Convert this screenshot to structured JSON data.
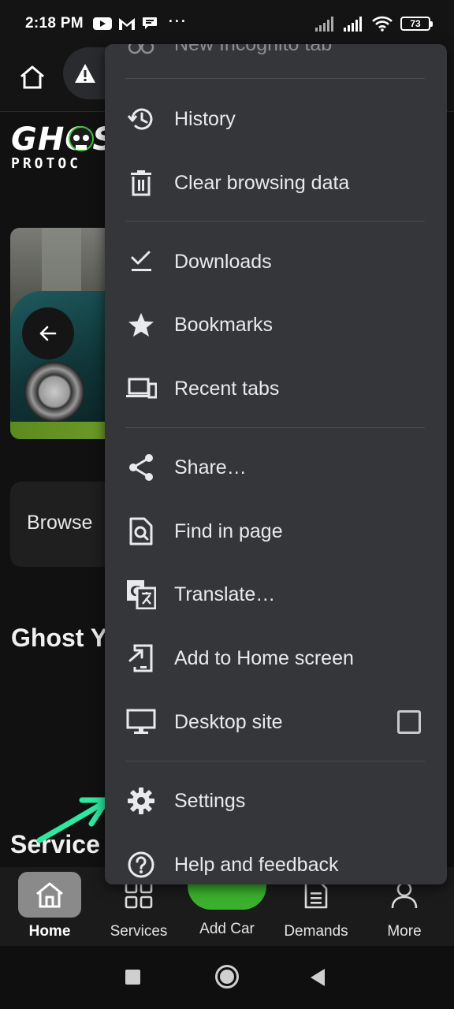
{
  "status_bar": {
    "time": "2:18 PM",
    "dots": "···",
    "battery": "73"
  },
  "page": {
    "logo_top": "GHOS",
    "logo_bottom": "PROTOC",
    "browse_text": "Browse",
    "ghost_heading": "Ghost Y",
    "services_heading": "Service"
  },
  "menu": {
    "partial_item": "New Incognito tab",
    "items": [
      {
        "label": "History",
        "icon": "history-icon"
      },
      {
        "label": "Clear browsing data",
        "icon": "trash-icon"
      },
      {
        "label": "Downloads",
        "icon": "download-icon"
      },
      {
        "label": "Bookmarks",
        "icon": "star-icon"
      },
      {
        "label": "Recent tabs",
        "icon": "devices-icon"
      },
      {
        "label": "Share…",
        "icon": "share-icon"
      },
      {
        "label": "Find in page",
        "icon": "find-in-page-icon"
      },
      {
        "label": "Translate…",
        "icon": "translate-icon"
      },
      {
        "label": "Add to Home screen",
        "icon": "add-to-home-icon"
      },
      {
        "label": "Desktop site",
        "icon": "desktop-icon",
        "checked": false
      },
      {
        "label": "Settings",
        "icon": "gear-icon"
      },
      {
        "label": "Help and feedback",
        "icon": "help-icon"
      }
    ]
  },
  "bottom_nav": {
    "items": [
      {
        "label": "Home",
        "icon": "home-icon",
        "active": true
      },
      {
        "label": "Services",
        "icon": "grid-icon"
      },
      {
        "label": "Add Car",
        "icon": "plus-icon"
      },
      {
        "label": "Demands",
        "icon": "document-icon"
      },
      {
        "label": "More",
        "icon": "user-icon"
      }
    ]
  },
  "colors": {
    "menu_bg": "#35363a",
    "accent_green": "#3ab02d",
    "arrow": "#2ee8a0"
  }
}
